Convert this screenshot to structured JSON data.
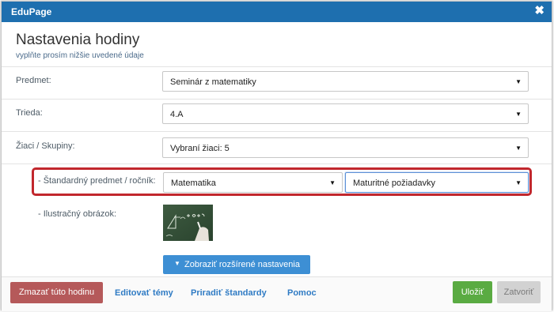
{
  "window": {
    "title": "EduPage",
    "close_glyph": "✖"
  },
  "header": {
    "title": "Nastavenia hodiny",
    "subtitle": "vyplňte prosím nižšie uvedené údaje"
  },
  "form": {
    "subject": {
      "label": "Predmet:",
      "value": "Seminár z matematiky"
    },
    "class": {
      "label": "Trieda:",
      "value": "4.A"
    },
    "students": {
      "label": "Žiaci / Skupiny:",
      "value": "Vybraní žiaci: 5"
    },
    "standard": {
      "label": "- Štandardný predmet / ročník:",
      "subject_value": "Matematika",
      "grade_value": "Maturitné požiadavky"
    },
    "illustration": {
      "label": "- Ilustračný obrázok:",
      "icon": "math-blackboard-image"
    }
  },
  "advanced_button": {
    "icon_glyph": "▼",
    "label": "Zobraziť rozšírené nastavenia"
  },
  "footer": {
    "delete_label": "Zmazať túto hodinu",
    "edit_topics_label": "Editovať témy",
    "assign_standards_label": "Priradiť štandardy",
    "help_label": "Pomoc",
    "save_label": "Uložiť",
    "close_label": "Zatvoriť"
  },
  "arrow_glyph": "▼",
  "colors": {
    "titlebar": "#1e6faf",
    "highlight": "#c1272d",
    "save": "#5aab42",
    "delete": "#b5595a",
    "link": "#2f7bc4"
  }
}
